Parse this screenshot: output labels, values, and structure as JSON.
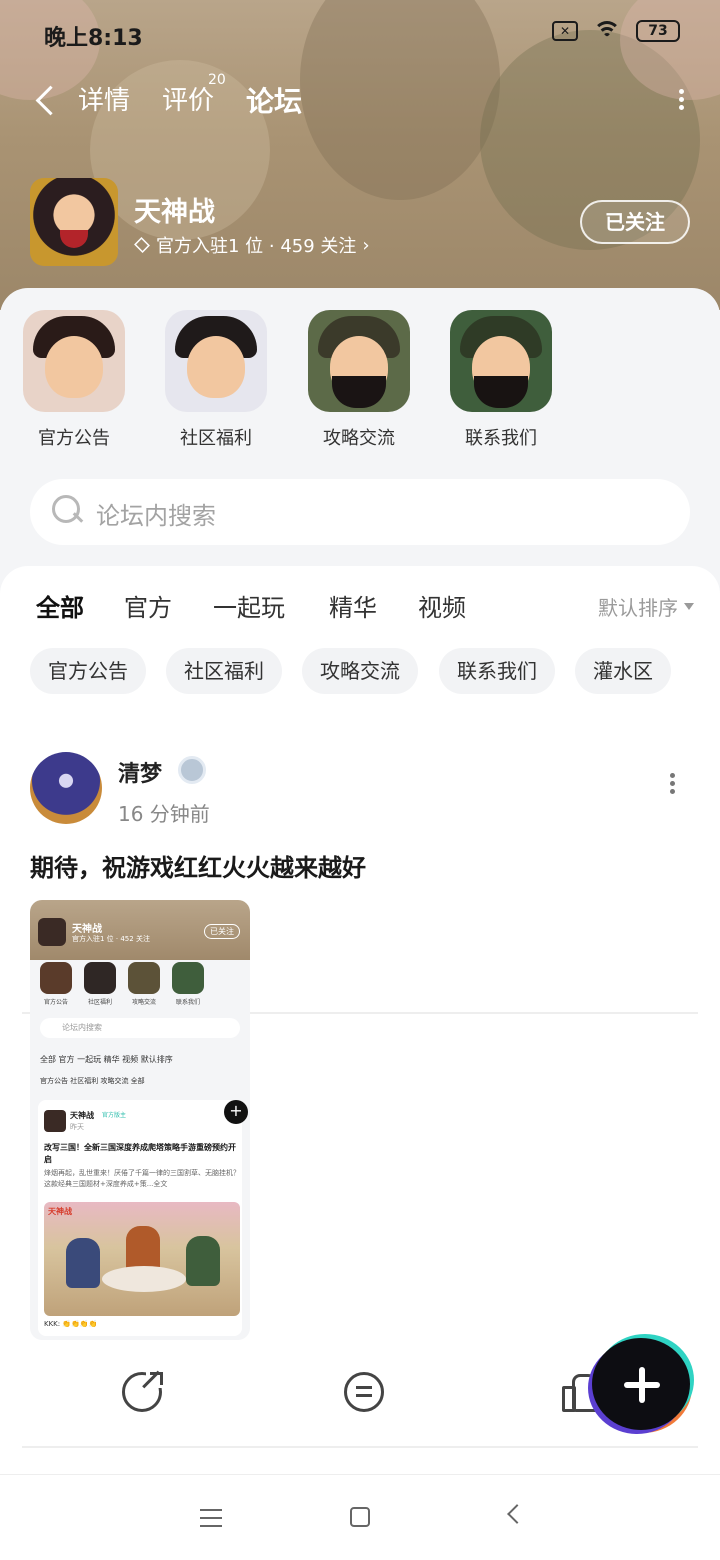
{
  "status": {
    "time": "晚上8:13",
    "battery": "73",
    "box_icon": "close-box-icon"
  },
  "nav": {
    "tabs": [
      {
        "label": "详情"
      },
      {
        "label": "评价",
        "badge": "20"
      },
      {
        "label": "论坛",
        "active": true
      }
    ]
  },
  "game": {
    "name": "天神战",
    "meta": "官方入驻1 位 · 459 关注",
    "follow_label": "已关注"
  },
  "quick_links": [
    {
      "label": "官方公告"
    },
    {
      "label": "社区福利"
    },
    {
      "label": "攻略交流"
    },
    {
      "label": "联系我们"
    }
  ],
  "search": {
    "placeholder": "论坛内搜索"
  },
  "feed_tabs": [
    {
      "label": "全部",
      "active": true
    },
    {
      "label": "官方"
    },
    {
      "label": "一起玩"
    },
    {
      "label": "精华"
    },
    {
      "label": "视频"
    }
  ],
  "sort_label": "默认排序",
  "chips": [
    "官方公告",
    "社区福利",
    "攻略交流",
    "联系我们",
    "灌水区"
  ],
  "post": {
    "user": "清梦",
    "time": "16 分钟前",
    "text": "期待，祝游戏红红火火越来越好",
    "thumbnail": {
      "name": "天神战",
      "meta": "官方入驻1 位 · 452 关注",
      "follow": "已关注",
      "quick": [
        "官方公告",
        "社区福利",
        "攻略交流",
        "联系我们"
      ],
      "search": "论坛内搜索",
      "tabs": "全部   官方   一起玩   精华   视频          默认排序",
      "chips": "官方公告   社区福利   攻略交流   全部",
      "card_user": "天神战",
      "card_badge": "官方版主",
      "card_time": "昨天",
      "card_title": "改写三国！全新三国深度养成爬塔策略手游重磅预约开启",
      "card_body": "烽烟再起，乱世重来！厌倦了千篇一律的三国割草、无脑挂机？这款经典三国题材+深度养成+策...全文",
      "card_image_label": "天神战",
      "card_footer": "KKK: 👏👏👏👏"
    }
  },
  "actions": {
    "share": "share-icon",
    "comment": "comment-icon",
    "like": "like-icon"
  },
  "colors": {
    "accent": "#2fd3c3",
    "fab": "#0d0d12"
  }
}
